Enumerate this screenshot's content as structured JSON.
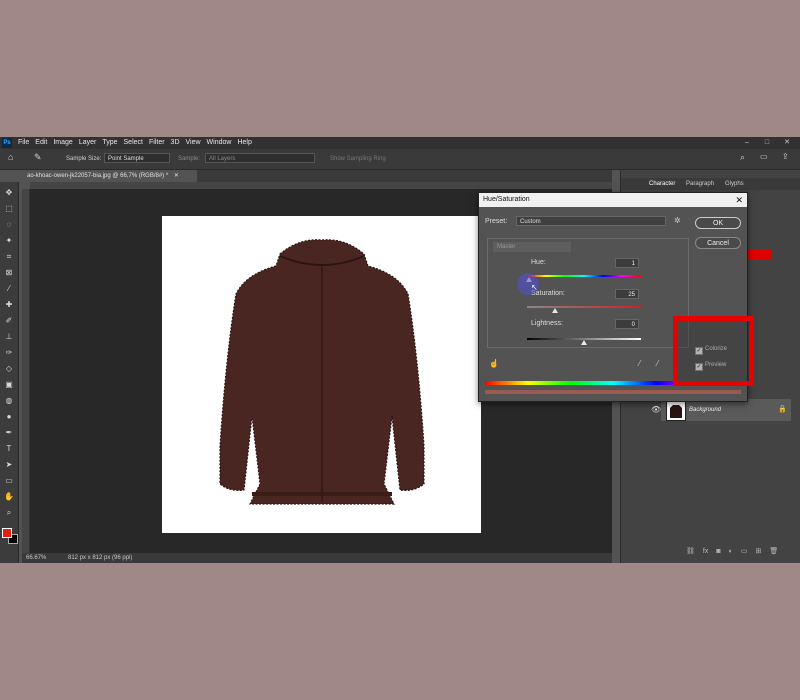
{
  "app": {
    "logo": "Ps",
    "menus": [
      "File",
      "Edit",
      "Image",
      "Layer",
      "Type",
      "Select",
      "Filter",
      "3D",
      "View",
      "Window",
      "Help"
    ],
    "window_controls": {
      "minimize": "–",
      "maximize": "□",
      "close": "✕"
    }
  },
  "options_bar": {
    "sample_size_label": "Sample Size:",
    "sample_size_value": "Point Sample",
    "sample_label": "Sample:",
    "sample_value": "All Layers",
    "show_ring": "Show Sampling Ring"
  },
  "document": {
    "tab_title": "ao-khoac-owen-jk22057-bia.jpg @ 66,7% (RGB/8#) *",
    "zoom": "66.67%",
    "dimensions": "812 px x 812 px (96 ppi)"
  },
  "right_panel": {
    "tabs": [
      "Character",
      "Paragraph",
      "Glyphs"
    ],
    "layer_name": "Background"
  },
  "dialog": {
    "title": "Hue/Saturation",
    "close": "✕",
    "preset_label": "Preset:",
    "preset_value": "Custom",
    "ok": "OK",
    "cancel": "Cancel",
    "channel": "Master",
    "hue_label": "Hue:",
    "hue_value": "1",
    "saturation_label": "Saturation:",
    "saturation_value": "25",
    "lightness_label": "Lightness:",
    "lightness_value": "0",
    "colorize_label": "Colorize",
    "preview_label": "Preview",
    "colorize_checked": true,
    "preview_checked": true
  },
  "colors": {
    "highlight": "#e60000",
    "jacket": "#4a2622",
    "foreground_swatch": "#e02010",
    "background_swatch": "#000000"
  },
  "icons": [
    "home-icon",
    "eyedropper-icon",
    "search-icon",
    "gear-icon",
    "lock-icon",
    "eye-icon",
    "hand-icon"
  ]
}
